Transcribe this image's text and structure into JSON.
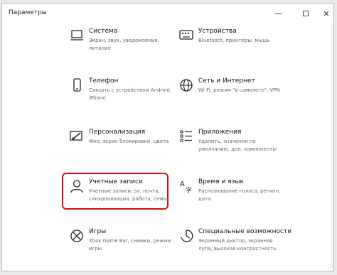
{
  "window": {
    "title": "Параметры"
  },
  "tiles": [
    {
      "name": "Система",
      "desc": "Экран, звук, уведомления, питание",
      "icon": "laptop-icon"
    },
    {
      "name": "Устройства",
      "desc": "Bluetooth, принтеры, мышь",
      "icon": "keyboard-icon"
    },
    {
      "name": "Телефон",
      "desc": "Связать с устройством Android, iPhone",
      "icon": "phone-icon"
    },
    {
      "name": "Сеть и Интернет",
      "desc": "Wi-Fi, режим \"в самолете\", VPN",
      "icon": "globe-icon"
    },
    {
      "name": "Персонализация",
      "desc": "Фон, экран блокировки, цвета",
      "icon": "paintbrush-icon"
    },
    {
      "name": "Приложения",
      "desc": "Удалить, значения по умолчанию, доп. компоненты",
      "icon": "apps-list-icon"
    },
    {
      "name": "Учетные записи",
      "desc": "Учетные записи, эл. почта, синхронизация, работа, семья",
      "icon": "user-icon"
    },
    {
      "name": "Время и язык",
      "desc": "Распознавание голоса, регион, дата",
      "icon": "time-language-icon"
    },
    {
      "name": "Игры",
      "desc": "Xbox Game Bar, снимки, режим игры",
      "icon": "xbox-icon"
    },
    {
      "name": "Специальные возможности",
      "desc": "Экранный диктор, экранная лупа, высокая контрастность",
      "icon": "accessibility-icon"
    }
  ],
  "colors": {
    "highlight": "#d20f0f",
    "text": "#111111",
    "muted": "#666666"
  }
}
